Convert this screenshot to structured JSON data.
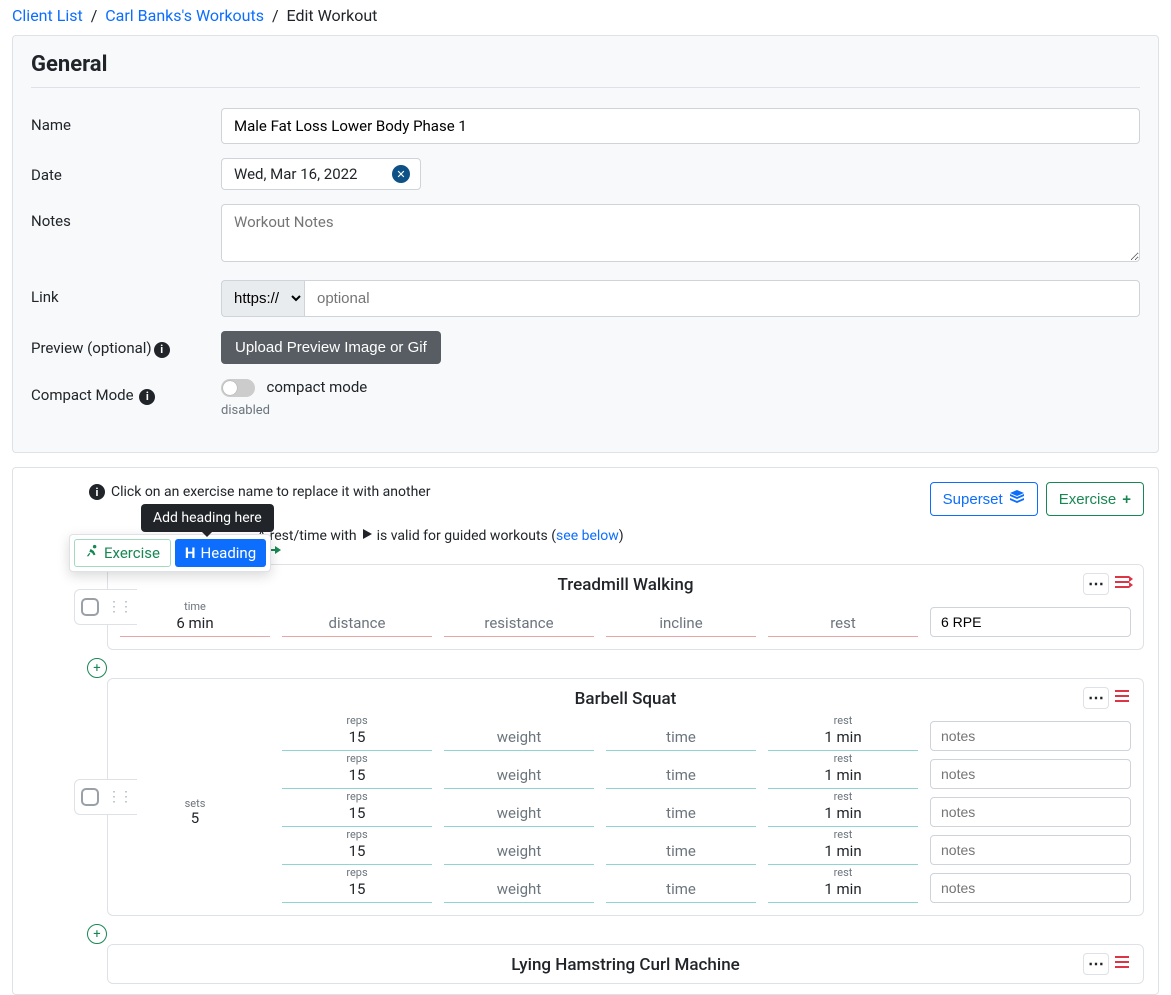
{
  "breadcrumb": {
    "client_list": "Client List",
    "workouts": "Carl Banks's Workouts",
    "current": "Edit Workout"
  },
  "general": {
    "heading": "General",
    "name_label": "Name",
    "name_value": "Male Fat Loss Lower Body Phase 1",
    "date_label": "Date",
    "date_value": "Wed, Mar 16, 2022",
    "notes_label": "Notes",
    "notes_placeholder": "Workout Notes",
    "link_label": "Link",
    "protocol": "https://",
    "link_placeholder": "optional",
    "preview_label": "Preview (optional)",
    "upload_btn": "Upload Preview Image or Gif",
    "compact_label": "Compact Mode",
    "compact_mode_text": "compact mode",
    "disabled_text": "disabled"
  },
  "hints": {
    "replace": "Click on an exercise name to replace it with another",
    "rest_prefix": "A rest/time with",
    "rest_suffix": "is valid for guided workouts (",
    "see_below": "see below",
    "closing": ")",
    "tooltip": "Add heading here"
  },
  "buttons": {
    "superset": "Superset",
    "exercise": "Exercise",
    "popover_exercise": "Exercise",
    "popover_heading": "Heading"
  },
  "exercises": [
    {
      "title": "Treadmill Walking",
      "type": "single",
      "row": {
        "time_label": "time",
        "time_value": "6 min",
        "distance": "distance",
        "resistance": "resistance",
        "incline": "incline",
        "rest": "rest",
        "notes_value": "6 RPE"
      }
    },
    {
      "title": "Barbell Squat",
      "type": "multi",
      "sets_label": "sets",
      "sets_value": "5",
      "rows": [
        {
          "reps_label": "reps",
          "reps": "15",
          "weight": "weight",
          "time": "time",
          "rest_label": "rest",
          "rest": "1 min",
          "notes": "notes"
        },
        {
          "reps_label": "reps",
          "reps": "15",
          "weight": "weight",
          "time": "time",
          "rest_label": "rest",
          "rest": "1 min",
          "notes": "notes"
        },
        {
          "reps_label": "reps",
          "reps": "15",
          "weight": "weight",
          "time": "time",
          "rest_label": "rest",
          "rest": "1 min",
          "notes": "notes"
        },
        {
          "reps_label": "reps",
          "reps": "15",
          "weight": "weight",
          "time": "time",
          "rest_label": "rest",
          "rest": "1 min",
          "notes": "notes"
        },
        {
          "reps_label": "reps",
          "reps": "15",
          "weight": "weight",
          "time": "time",
          "rest_label": "rest",
          "rest": "1 min",
          "notes": "notes"
        }
      ]
    },
    {
      "title": "Lying Hamstring Curl Machine",
      "type": "partial"
    }
  ],
  "col_placeholders": {
    "weight": "weight",
    "time": "time",
    "rest": "rest",
    "notes": "notes"
  }
}
